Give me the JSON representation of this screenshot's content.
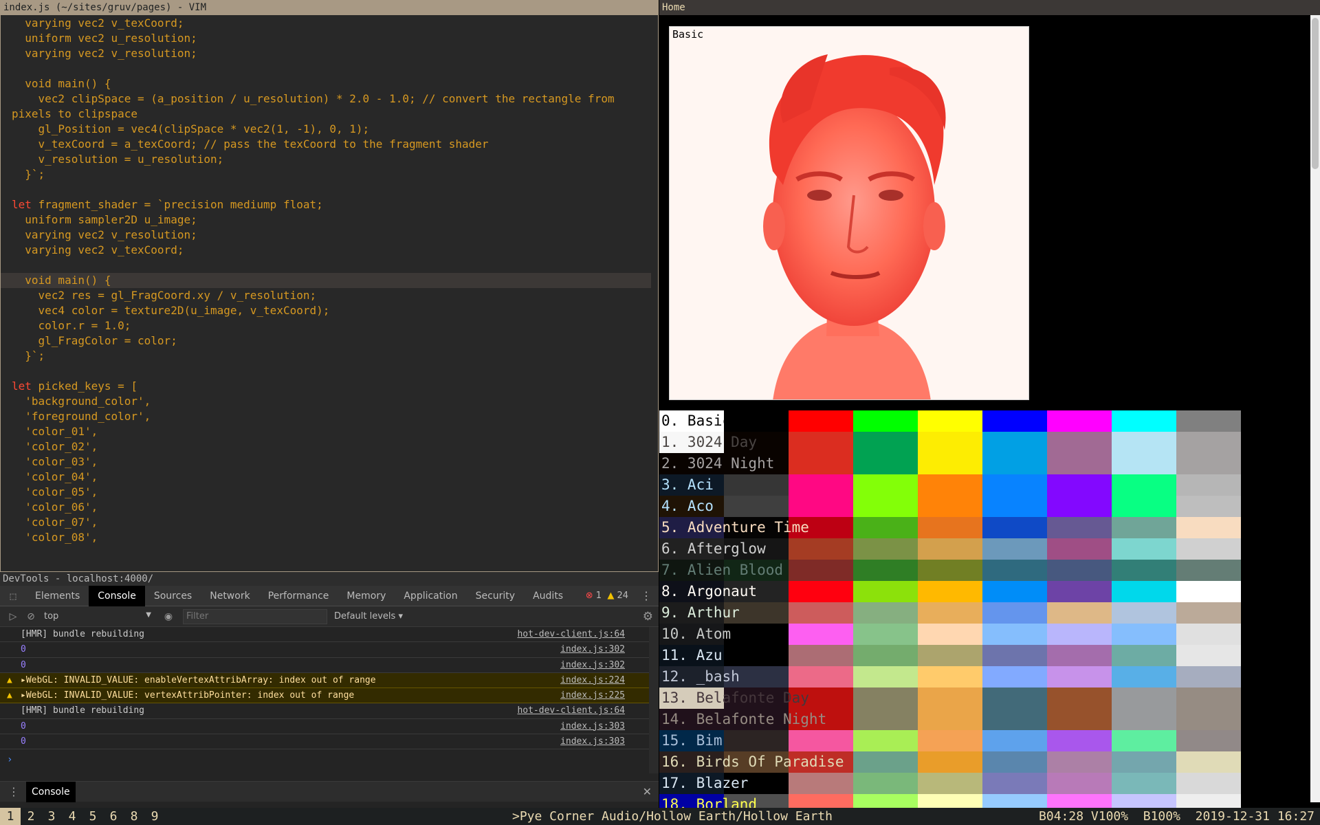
{
  "vim": {
    "title": "index.js (~/sites/gruv/pages) - VIM",
    "lines": [
      "  varying vec2 v_texCoord;",
      "  uniform vec2 u_resolution;",
      "  varying vec2 v_resolution;",
      "",
      "  void main() {",
      "    vec2 clipSpace = (a_position / u_resolution) * 2.0 - 1.0; // convert the rectangle from",
      "pixels to clipspace",
      "    gl_Position = vec4(clipSpace * vec2(1, -1), 0, 1);",
      "    v_texCoord = a_texCoord; // pass the texCoord to the fragment shader",
      "    v_resolution = u_resolution;",
      "  }`;",
      "",
      "let fragment_shader = `precision mediump float;",
      "  uniform sampler2D u_image;",
      "  varying vec2 v_resolution;",
      "  varying vec2 v_texCoord;",
      "",
      "  void main() {",
      "    vec2 res = gl_FragCoord.xy / v_resolution;",
      "    vec4 color = texture2D(u_image, v_texCoord);",
      "    color.r = 1.0;",
      "    gl_FragColor = color;",
      "  }`;",
      "",
      "let picked_keys = [",
      "  'background_color',",
      "  'foreground_color',",
      "  'color_01',",
      "  'color_02',",
      "  'color_03',",
      "  'color_04',",
      "  'color_05',",
      "  'color_06',",
      "  'color_07',",
      "  'color_08',"
    ],
    "current_line": 17
  },
  "browser": {
    "title": "Home",
    "preview_label": "Basic"
  },
  "themes": [
    {
      "name": "0. Basic",
      "fg": "#000000",
      "colors": [
        "#ffffff",
        "#000000",
        "#ff0000",
        "#00ff00",
        "#ffff00",
        "#0000ff",
        "#ff00ff",
        "#00ffff",
        "#808080"
      ]
    },
    {
      "name": "1. 3024 Day",
      "fg": "#4a4543",
      "colors": [
        "#f7f7f7",
        "#090300",
        "#db2d20",
        "#01a252",
        "#fded02",
        "#01a0e4",
        "#a16a94",
        "#b5e4f4",
        "#a5a2a2"
      ]
    },
    {
      "name": "2. 3024 Night",
      "fg": "#a5a2a2",
      "colors": [
        "#090300",
        "#090300",
        "#db2d20",
        "#01a252",
        "#fded02",
        "#01a0e4",
        "#a16a94",
        "#b5e4f4",
        "#a5a2a2"
      ]
    },
    {
      "name": "3. Aci",
      "fg": "#b4e1fd",
      "colors": [
        "#0d1926",
        "#363636",
        "#ff0883",
        "#83ff08",
        "#ff8308",
        "#0883ff",
        "#8308ff",
        "#08ff83",
        "#b6b6b6"
      ]
    },
    {
      "name": "4. Aco",
      "fg": "#b4e1fd",
      "colors": [
        "#1f1305",
        "#3f3f3f",
        "#ff0883",
        "#83ff08",
        "#ff8308",
        "#0883ff",
        "#8308ff",
        "#08ff83",
        "#bebebe"
      ]
    },
    {
      "name": "5. Adventure Time",
      "fg": "#f8dcc0",
      "colors": [
        "#1f1d45",
        "#050404",
        "#bd0013",
        "#4ab118",
        "#e7741e",
        "#0f4ac6",
        "#665993",
        "#70a598",
        "#f8dcc0"
      ]
    },
    {
      "name": "6. Afterglow",
      "fg": "#d0d0d0",
      "colors": [
        "#212121",
        "#151515",
        "#a53c23",
        "#7b9246",
        "#d3a04d",
        "#6c99bb",
        "#9f4e85",
        "#7dd6cf",
        "#d0d0d0"
      ]
    },
    {
      "name": "7. Alien Blood",
      "fg": "#637d75",
      "colors": [
        "#0f1610",
        "#112616",
        "#7f2b27",
        "#2f7e25",
        "#717f24",
        "#2f6a7f",
        "#47587f",
        "#327f77",
        "#647d75"
      ]
    },
    {
      "name": "8. Argonaut",
      "fg": "#fffaf4",
      "colors": [
        "#0e1019",
        "#232323",
        "#ff000f",
        "#8ce10b",
        "#ffb900",
        "#008df8",
        "#6d43a6",
        "#00d8eb",
        "#ffffff"
      ]
    },
    {
      "name": "9. Arthur",
      "fg": "#ddeedd",
      "colors": [
        "#1c1c1c",
        "#3d352a",
        "#cd5c5c",
        "#86af80",
        "#e8ae5b",
        "#6495ed",
        "#deb887",
        "#b0c4de",
        "#bbaa99"
      ]
    },
    {
      "name": "10. Atom",
      "fg": "#c5c8c6",
      "colors": [
        "#161719",
        "#000000",
        "#fd5ff1",
        "#87c38a",
        "#ffd7b1",
        "#85befd",
        "#b9b6fc",
        "#85befd",
        "#e0e0e0"
      ]
    },
    {
      "name": "11. Azu",
      "fg": "#d9e6f2",
      "colors": [
        "#09111a",
        "#000000",
        "#ac6d74",
        "#74ac6d",
        "#aca46d",
        "#6d74ac",
        "#a46dac",
        "#6daca4",
        "#e6e6e6"
      ]
    },
    {
      "name": "12. _bash",
      "fg": "#c2c8d7",
      "colors": [
        "#1c212b",
        "#2c3043",
        "#ec6a88",
        "#c3e88d",
        "#ffcb6b",
        "#82aaff",
        "#c792ea",
        "#58afe7",
        "#a6adbf"
      ]
    },
    {
      "name": "13. Belafonte Day",
      "fg": "#45373c",
      "colors": [
        "#d5ccba",
        "#20111b",
        "#be100e",
        "#858162",
        "#eaa549",
        "#426a79",
        "#97522c",
        "#989a9c",
        "#968c83"
      ]
    },
    {
      "name": "14. Belafonte Night",
      "fg": "#968c83",
      "colors": [
        "#20111b",
        "#20111b",
        "#be100e",
        "#858162",
        "#eaa549",
        "#426a79",
        "#97522c",
        "#989a9c",
        "#968c83"
      ]
    },
    {
      "name": "15. Bim",
      "fg": "#a9bed8",
      "colors": [
        "#012849",
        "#2c2423",
        "#f557a0",
        "#a9ee55",
        "#f5a255",
        "#5ea2ec",
        "#a957ec",
        "#5eeea0",
        "#918988"
      ]
    },
    {
      "name": "16. Birds Of Paradise",
      "fg": "#e0dbb7",
      "colors": [
        "#2a1f1d",
        "#573d26",
        "#be2d26",
        "#6ba18a",
        "#e99d2a",
        "#5a86ad",
        "#ac80a6",
        "#74a6ad",
        "#e0dbb7"
      ]
    },
    {
      "name": "17. Blazer",
      "fg": "#d9e6f2",
      "colors": [
        "#0d1926",
        "#000000",
        "#b87a7a",
        "#7ab87a",
        "#b8b87a",
        "#7a7ab8",
        "#b87ab8",
        "#7ab8b8",
        "#d9d9d9"
      ]
    },
    {
      "name": "18. Borland",
      "fg": "#ffff4e",
      "colors": [
        "#0000a4",
        "#4f4f4f",
        "#ff6c60",
        "#a8ff60",
        "#ffffb6",
        "#96cbfe",
        "#ff73fd",
        "#c6c5fe",
        "#eeeeee"
      ]
    }
  ],
  "devtools": {
    "title": "DevTools - localhost:4000/",
    "tabs": [
      "Elements",
      "Console",
      "Sources",
      "Network",
      "Performance",
      "Memory",
      "Application",
      "Security",
      "Audits"
    ],
    "active_tab": "Console",
    "error_count": "1",
    "warning_count": "24",
    "context": "top",
    "filter_placeholder": "Filter",
    "levels": "Default levels",
    "drawer_tab": "Console",
    "logs": [
      {
        "type": "info",
        "msg": "[HMR] bundle rebuilding",
        "src": "hot-dev-client.js:64"
      },
      {
        "type": "num",
        "msg": "0",
        "src": "index.js:302"
      },
      {
        "type": "num",
        "msg": "0",
        "src": "index.js:302"
      },
      {
        "type": "warn",
        "msg": "▸WebGL: INVALID_VALUE: enableVertexAttribArray: index out of range",
        "src": "index.js:224"
      },
      {
        "type": "warn",
        "msg": "▸WebGL: INVALID_VALUE: vertexAttribPointer: index out of range",
        "src": "index.js:225"
      },
      {
        "type": "info",
        "msg": "[HMR] bundle rebuilding",
        "src": "hot-dev-client.js:64"
      },
      {
        "type": "num",
        "msg": "0",
        "src": "index.js:303"
      },
      {
        "type": "num",
        "msg": "0",
        "src": "index.js:303"
      }
    ]
  },
  "statusbar": {
    "workspaces": [
      "1",
      "2",
      "3",
      "4",
      "5",
      "6",
      "8",
      "9"
    ],
    "active_workspace": "1",
    "now_playing": ">Pye Corner Audio/Hollow Earth/Hollow Earth",
    "system": "B04:28 V100%  B100%  2019-12-31 16:27"
  }
}
